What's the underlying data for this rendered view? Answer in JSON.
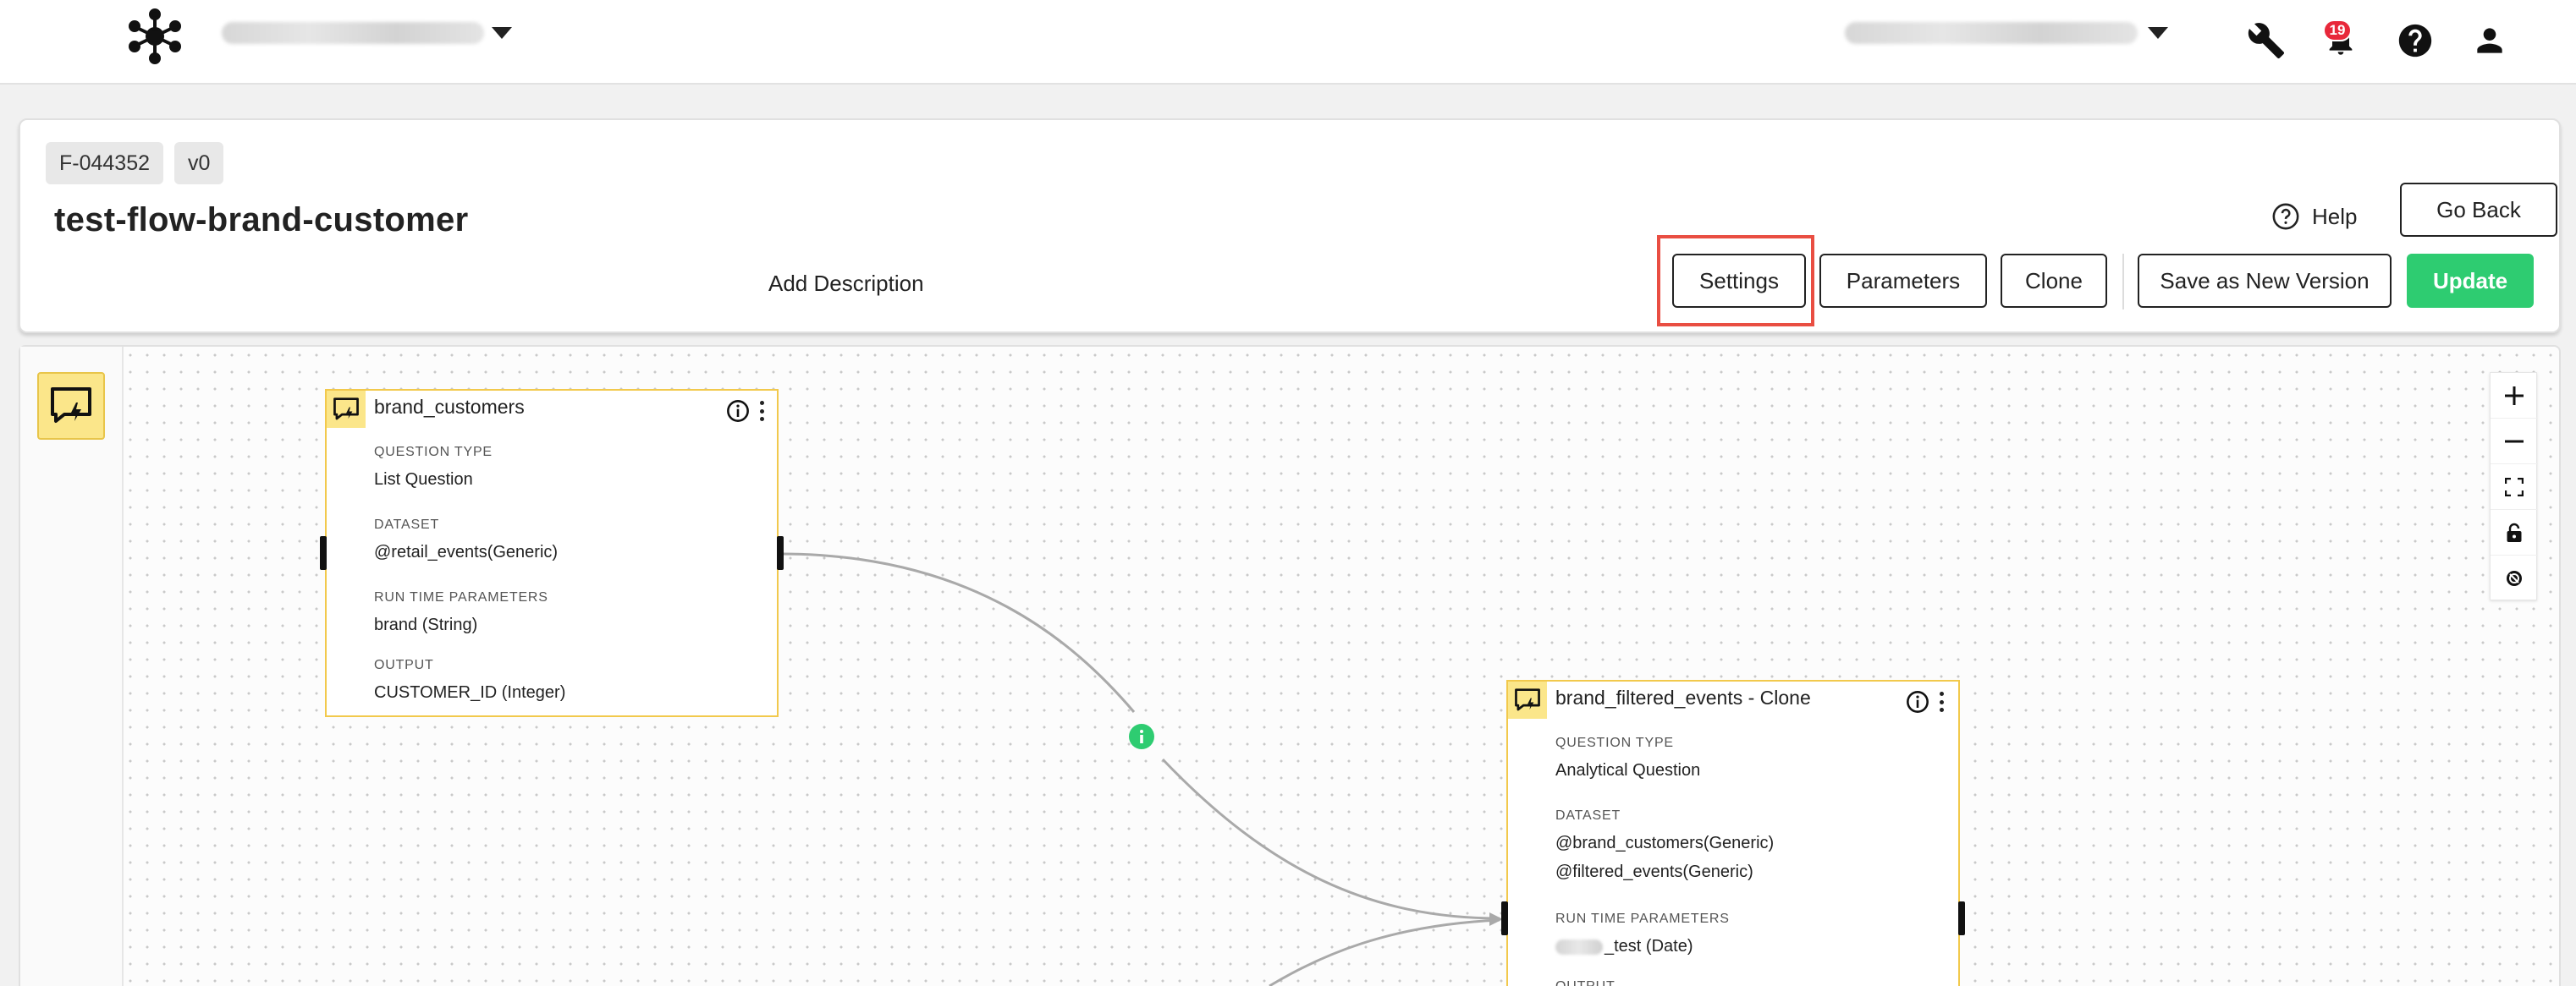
{
  "topbar": {
    "workspace_selector": "",
    "user_selector": "",
    "notification_count": "19"
  },
  "header": {
    "flow_id": "F-044352",
    "version": "v0",
    "title": "test-flow-brand-customer",
    "add_description": "Add Description",
    "help_label": "Help",
    "go_back_label": "Go Back",
    "buttons": {
      "settings": "Settings",
      "parameters": "Parameters",
      "clone": "Clone",
      "save_as_new_version": "Save as New Version",
      "update": "Update"
    }
  },
  "colors": {
    "accent_green": "#2ecc71",
    "node_border": "#f2c94c",
    "node_icon_bg": "#fbe68a",
    "highlight_red": "#e94e42",
    "badge_red": "#e8283a"
  },
  "nodes": [
    {
      "title": "brand_customers",
      "fields": [
        {
          "label": "QUESTION TYPE",
          "values": [
            "List Question"
          ]
        },
        {
          "label": "DATASET",
          "values": [
            "@retail_events(Generic)"
          ]
        },
        {
          "label": "RUN TIME PARAMETERS",
          "values": [
            "brand (String)"
          ]
        },
        {
          "label": "OUTPUT",
          "values": [
            "CUSTOMER_ID (Integer)"
          ]
        }
      ]
    },
    {
      "title": "brand_filtered_events - Clone",
      "fields": [
        {
          "label": "QUESTION TYPE",
          "values": [
            "Analytical Question"
          ]
        },
        {
          "label": "DATASET",
          "values": [
            "@brand_customers(Generic)",
            "@filtered_events(Generic)"
          ]
        },
        {
          "label": "RUN TIME PARAMETERS",
          "values": [
            "_test (Date)"
          ]
        },
        {
          "label": "OUTPUT",
          "values": []
        }
      ]
    }
  ],
  "icons": {
    "logo": "network-logo-icon",
    "tools": "wrench-icon",
    "notifications": "bell-icon",
    "help": "question-circle-icon",
    "account": "user-icon",
    "zoom_in": "plus-icon",
    "zoom_out": "minus-icon",
    "fit_view": "fit-view-icon",
    "lock": "lock-icon",
    "reset": "reset-icon"
  }
}
